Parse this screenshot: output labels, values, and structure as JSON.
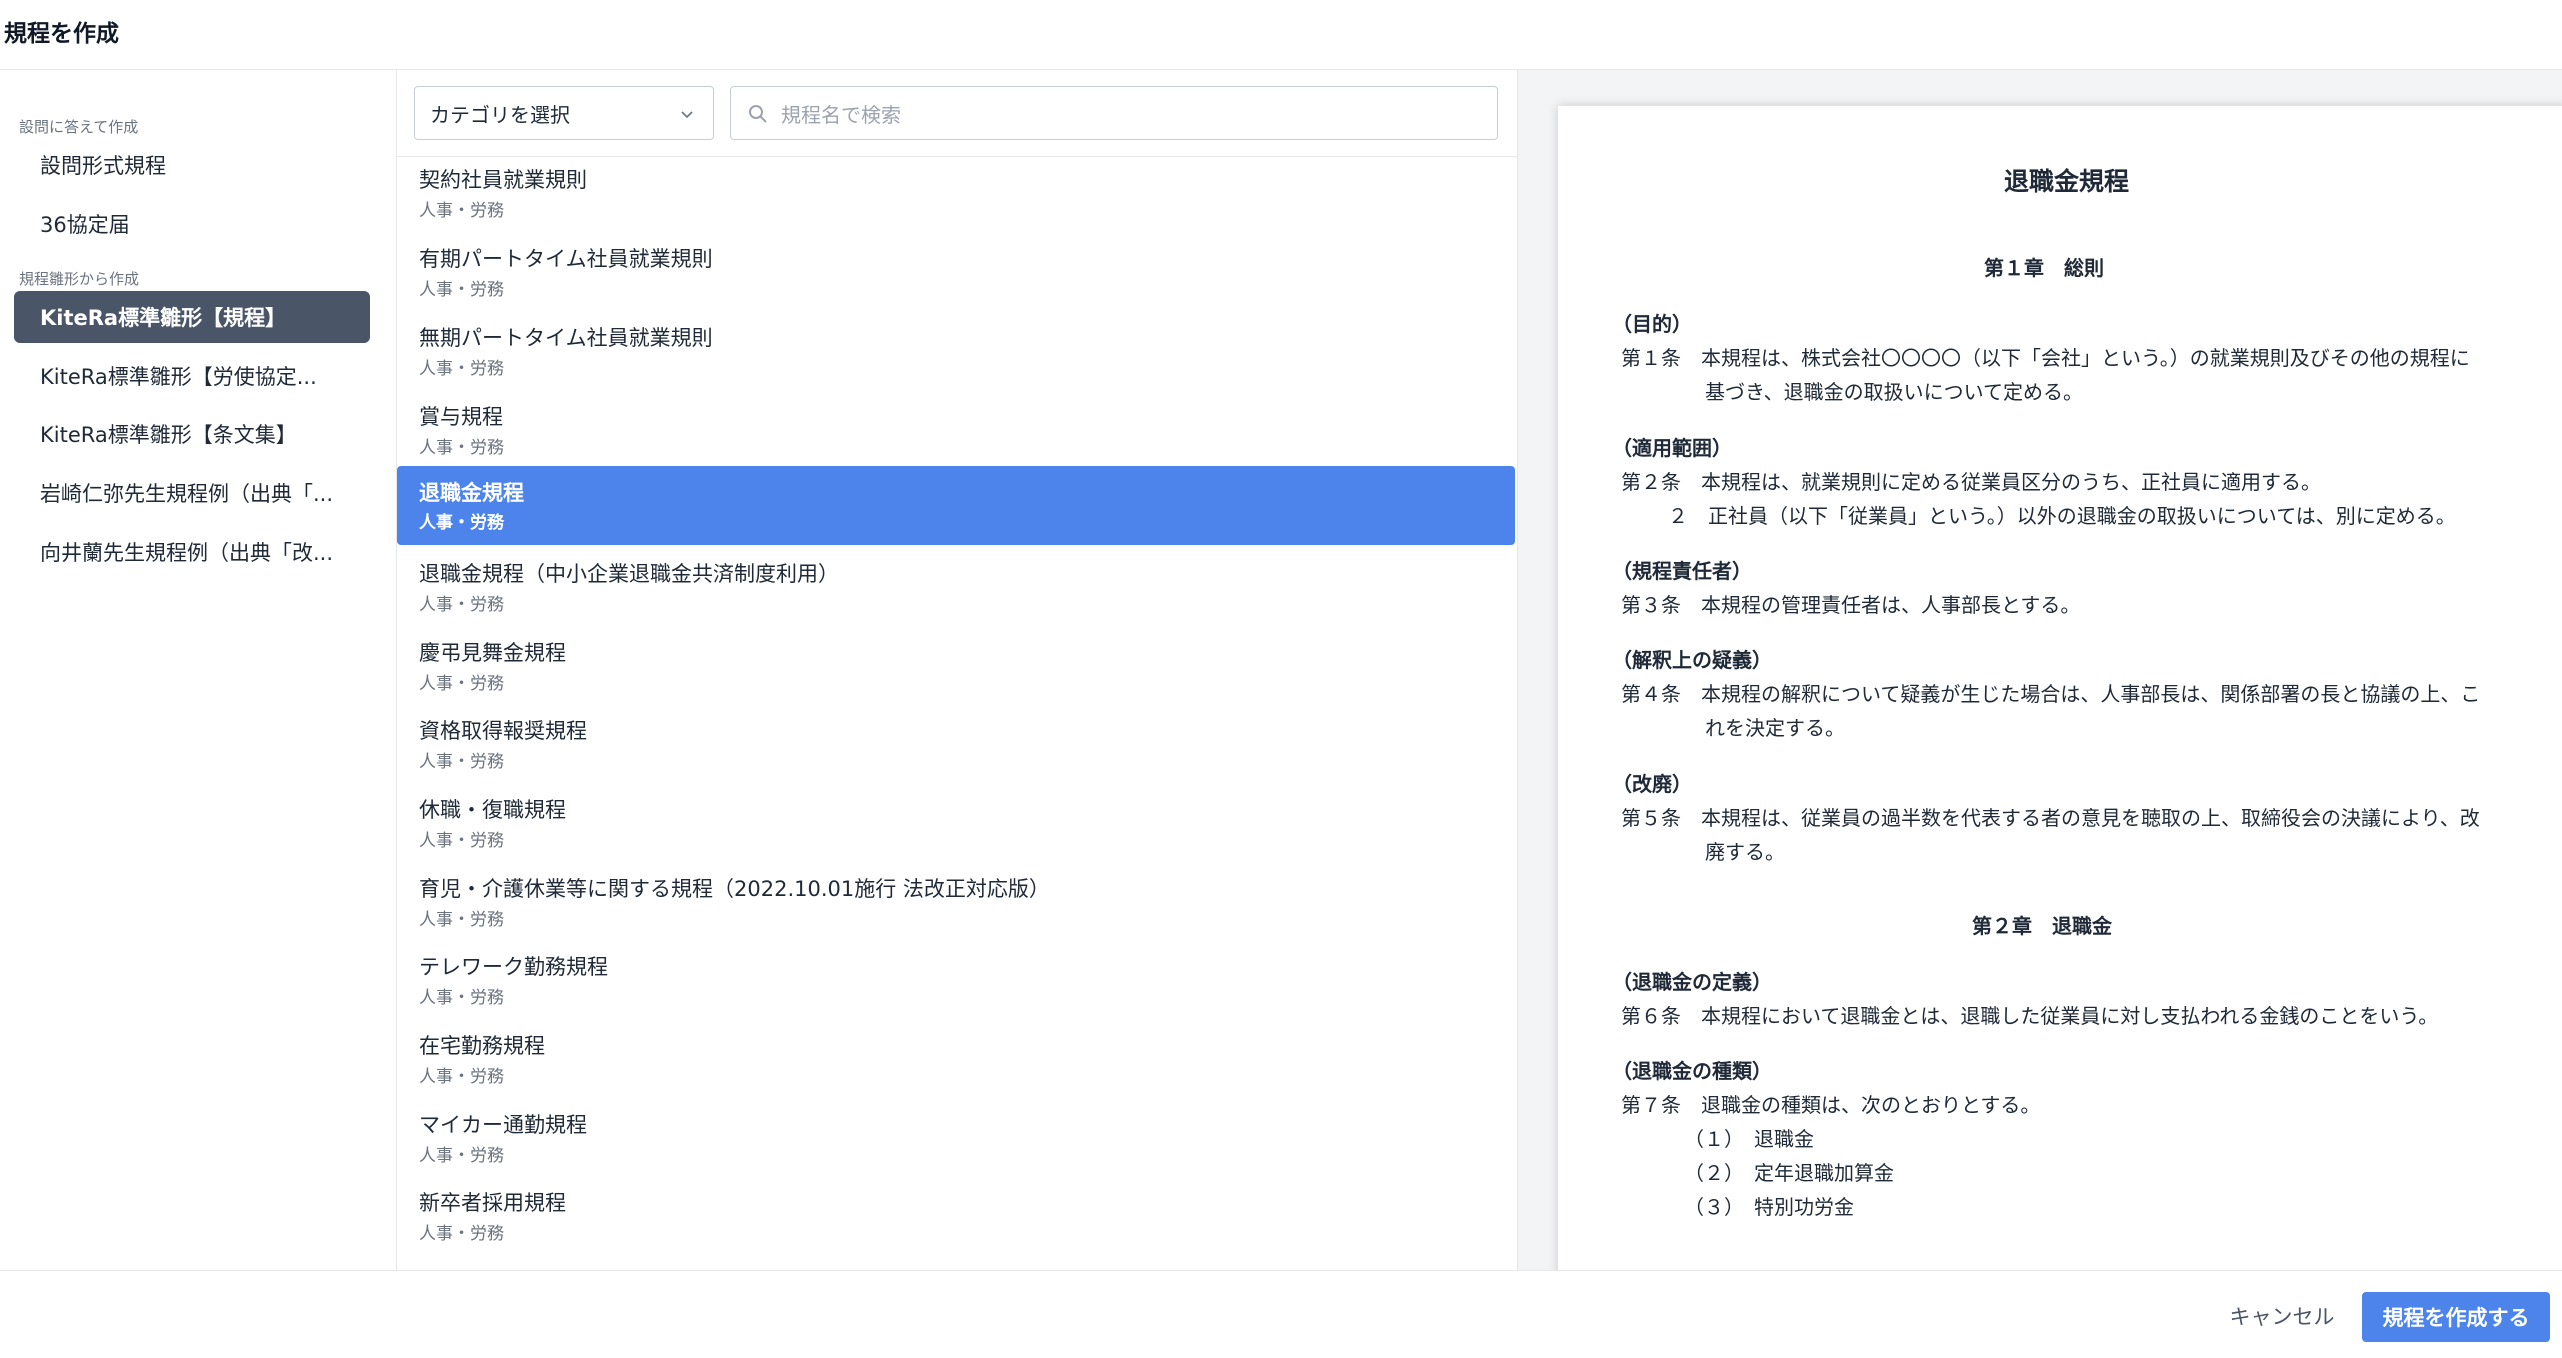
{
  "header": {
    "title": "規程を作成"
  },
  "sidebar": {
    "section1_label": "設問に答えて作成",
    "section1_items": [
      {
        "label": "設問形式規程"
      },
      {
        "label": "36協定届"
      }
    ],
    "section2_label": "規程雛形から作成",
    "section2_items": [
      {
        "label": "KiteRa標準雛形【規程】",
        "active": true
      },
      {
        "label": "KiteRa標準雛形【労使協定..."
      },
      {
        "label": "KiteRa標準雛形【条文集】"
      },
      {
        "label": "岩崎仁弥先生規程例（出典「..."
      },
      {
        "label": "向井蘭先生規程例（出典「改..."
      }
    ]
  },
  "toolbar": {
    "category_select": "カテゴリを選択",
    "search_placeholder": "規程名で検索"
  },
  "list": {
    "items": [
      {
        "name": "契約社員就業規則",
        "category": "人事・労務"
      },
      {
        "name": "有期パートタイム社員就業規則",
        "category": "人事・労務"
      },
      {
        "name": "無期パートタイム社員就業規則",
        "category": "人事・労務"
      },
      {
        "name": "賞与規程",
        "category": "人事・労務"
      },
      {
        "name": "退職金規程",
        "category": "人事・労務",
        "selected": true
      },
      {
        "name": "退職金規程（中小企業退職金共済制度利用）",
        "category": "人事・労務"
      },
      {
        "name": "慶弔見舞金規程",
        "category": "人事・労務"
      },
      {
        "name": "資格取得報奨規程",
        "category": "人事・労務"
      },
      {
        "name": "休職・復職規程",
        "category": "人事・労務"
      },
      {
        "name": "育児・介護休業等に関する規程（2022.10.01施行 法改正対応版）",
        "category": "人事・労務"
      },
      {
        "name": "テレワーク勤務規程",
        "category": "人事・労務"
      },
      {
        "name": "在宅勤務規程",
        "category": "人事・労務"
      },
      {
        "name": "マイカー通勤規程",
        "category": "人事・労務"
      },
      {
        "name": "新卒者採用規程",
        "category": "人事・労務"
      }
    ]
  },
  "preview": {
    "title": "退職金規程",
    "chapter1": "第１章　総則",
    "h_purpose": "（目的）",
    "a1_line1": "第１条　本規程は、株式会社〇〇〇〇（以下「会社」という。）の就業規則及びその他の規程に",
    "a1_line2": "基づき、退職金の取扱いについて定める。",
    "h_scope": "（適用範囲）",
    "a2_line1": "第２条　本規程は、就業規則に定める従業員区分のうち、正社員に適用する。",
    "a2_line2": "２　正社員（以下「従業員」という。）以外の退職金の取扱いについては、別に定める。",
    "h_resp": "（規程責任者）",
    "a3_line1": "第３条　本規程の管理責任者は、人事部長とする。",
    "h_doubt": "（解釈上の疑義）",
    "a4_line1": "第４条　本規程の解釈について疑義が生じた場合は、人事部長は、関係部署の長と協議の上、こ",
    "a4_line2": "れを決定する。",
    "h_repeal": "（改廃）",
    "a5_line1": "第５条　本規程は、従業員の過半数を代表する者の意見を聴取の上、取締役会の決議により、改",
    "a5_line2": "廃する。",
    "chapter2": "第２章　退職金",
    "h_def": "（退職金の定義）",
    "a6_line1": "第６条　本規程において退職金とは、退職した従業員に対し支払われる金銭のことをいう。",
    "h_types": "（退職金の種類）",
    "a7_line1": "第７条　退職金の種類は、次のとおりとする。",
    "a7_item1": "（１）　退職金",
    "a7_item2": "（２）　定年退職加算金",
    "a7_item3": "（３）　特別功労金"
  },
  "footer": {
    "cancel": "キャンセル",
    "create": "規程を作成する"
  }
}
